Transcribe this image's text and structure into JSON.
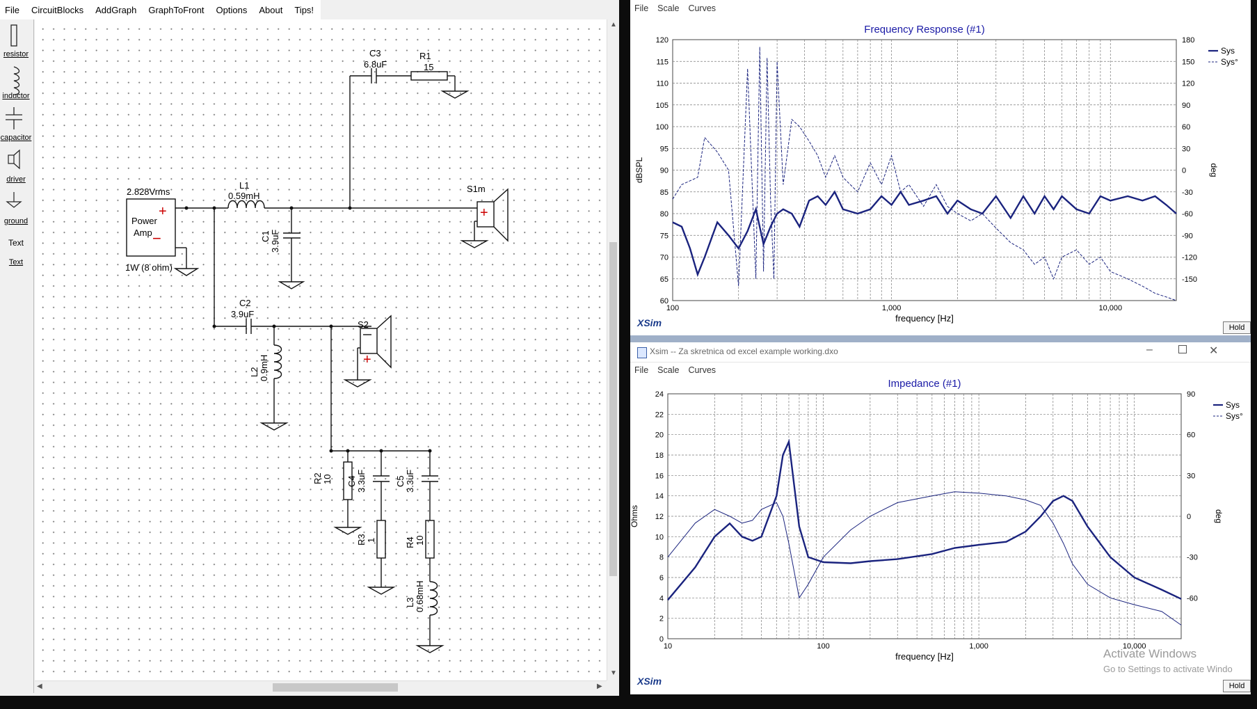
{
  "menu": [
    "File",
    "CircuitBlocks",
    "AddGraph",
    "GraphToFront",
    "Options",
    "About",
    "Tips!"
  ],
  "palette": [
    "resistor",
    "inductor",
    "capacitor",
    "driver",
    "ground",
    "Text",
    "Text"
  ],
  "circuit": {
    "source_voltage": "2.828Vrms",
    "source_name_1": "Power",
    "source_name_2": "Amp",
    "source_rating": "1W (8 ohm)",
    "L1_name": "L1",
    "L1_val": "0.59mH",
    "C3_name": "C3",
    "C3_val": "6.8uF",
    "R1_name": "R1",
    "R1_val": "15",
    "C1_name": "C1",
    "C1_val": "3.9uF",
    "S1_name": "S1m",
    "C2_name": "C2",
    "C2_val": "3.9uF",
    "L2_name": "L2",
    "L2_val": "0.9mH",
    "S2_name": "S2",
    "R2_name": "R2",
    "R2_val": "10",
    "C4_name": "C4",
    "C4_val": "3.3uF",
    "C5_name": "C5",
    "C5_val": "3.3uF",
    "R3_name": "R3",
    "R3_val": "1",
    "R4_name": "R4",
    "R4_val": "10",
    "L3_name": "L3",
    "L3_val": "0.68mH"
  },
  "graph_menu": [
    "File",
    "Scale",
    "Curves"
  ],
  "freq_window": {
    "hold_label": "Hold",
    "brand": "XSim"
  },
  "imp_window": {
    "title": "Xsim -- Za skretnica od excel example working.dxo",
    "hold_label": "Hold",
    "brand": "XSim"
  },
  "watermark": {
    "line1": "Activate Windows",
    "line2": "Go to Settings to activate Windo"
  },
  "colors": {
    "curve": "#1a237e",
    "title": "#1a1aa6",
    "grid": "#7a7a7a"
  },
  "chart_data": [
    {
      "type": "line",
      "title": "Frequency Response (#1)",
      "xlabel": "frequency [Hz]",
      "ylabel": "dBSPL",
      "y2label": "deg",
      "xscale": "log",
      "xlim": [
        100,
        20000
      ],
      "ylim": [
        60,
        120
      ],
      "y2lim": [
        -180,
        180
      ],
      "x_ticks": [
        "100",
        "1,000",
        "10,000"
      ],
      "y_ticks": [
        "60",
        "65",
        "70",
        "75",
        "80",
        "85",
        "90",
        "95",
        "100",
        "105",
        "110",
        "115",
        "120"
      ],
      "y2_ticks": [
        "-150",
        "-120",
        "-90",
        "-60",
        "-30",
        "0",
        "30",
        "60",
        "90",
        "120",
        "150",
        "180"
      ],
      "legend": [
        "Sys",
        "Sys°"
      ],
      "legend_position": "top-right",
      "series": [
        {
          "name": "Sys",
          "style": "solid",
          "x": [
            100,
            110,
            120,
            130,
            140,
            160,
            180,
            200,
            220,
            240,
            260,
            280,
            300,
            320,
            350,
            380,
            420,
            460,
            500,
            550,
            600,
            700,
            800,
            900,
            1000,
            1100,
            1200,
            1400,
            1600,
            1800,
            2000,
            2300,
            2600,
            3000,
            3500,
            4000,
            4500,
            5000,
            5500,
            6000,
            7000,
            8000,
            9000,
            10000,
            12000,
            14000,
            16000,
            18000,
            20000
          ],
          "y": [
            78,
            77,
            72,
            66,
            70,
            78,
            75,
            72,
            76,
            81,
            73,
            77,
            80,
            81,
            80,
            77,
            83,
            84,
            82,
            85,
            81,
            80,
            81,
            84,
            82,
            85,
            82,
            83,
            84,
            80,
            83,
            81,
            80,
            84,
            79,
            84,
            80,
            84,
            81,
            84,
            81,
            80,
            84,
            83,
            84,
            83,
            84,
            82,
            80
          ]
        },
        {
          "name": "Sys°",
          "style": "dashed",
          "x": [
            100,
            110,
            130,
            140,
            160,
            180,
            200,
            220,
            240,
            250,
            260,
            270,
            280,
            290,
            300,
            320,
            350,
            380,
            420,
            460,
            500,
            550,
            600,
            700,
            800,
            900,
            1000,
            1100,
            1200,
            1400,
            1600,
            1800,
            2000,
            2300,
            2600,
            3000,
            3500,
            4000,
            4500,
            5000,
            5500,
            6000,
            7000,
            8000,
            9000,
            10000,
            12000,
            14000,
            16000,
            18000,
            20000
          ],
          "y": [
            -40,
            -20,
            -10,
            45,
            25,
            0,
            -160,
            140,
            -150,
            170,
            -140,
            155,
            -40,
            -150,
            150,
            -20,
            70,
            60,
            40,
            20,
            -10,
            20,
            -10,
            -30,
            10,
            -20,
            20,
            -30,
            -20,
            -50,
            -20,
            -50,
            -60,
            -70,
            -60,
            -80,
            -100,
            -110,
            -130,
            -120,
            -150,
            -120,
            -110,
            -130,
            -120,
            -140,
            -150,
            -160,
            -170,
            -175,
            -180
          ]
        }
      ]
    },
    {
      "type": "line",
      "title": "Impedance (#1)",
      "xlabel": "frequency [Hz]",
      "ylabel": "Ohms",
      "y2label": "deg",
      "xscale": "log",
      "xlim": [
        10,
        20000
      ],
      "ylim": [
        0,
        24
      ],
      "y2lim": [
        -90,
        90
      ],
      "x_ticks": [
        "10",
        "100",
        "1,000",
        "10,000"
      ],
      "y_ticks": [
        "0",
        "2",
        "4",
        "6",
        "8",
        "10",
        "12",
        "14",
        "16",
        "18",
        "20",
        "22",
        "24"
      ],
      "y2_ticks": [
        "-60",
        "-30",
        "0",
        "30",
        "60",
        "90"
      ],
      "legend": [
        "Sys",
        "Sys°"
      ],
      "legend_position": "top-right",
      "series": [
        {
          "name": "Sys",
          "style": "solid",
          "x": [
            10,
            15,
            20,
            25,
            30,
            35,
            40,
            50,
            55,
            60,
            65,
            70,
            80,
            100,
            150,
            200,
            300,
            500,
            700,
            1000,
            1500,
            2000,
            2500,
            3000,
            3500,
            4000,
            5000,
            7000,
            10000,
            15000,
            20000
          ],
          "y": [
            3.8,
            7,
            10,
            11.3,
            10,
            9.6,
            10,
            14,
            18,
            19.3,
            15,
            11,
            8,
            7.5,
            7.4,
            7.6,
            7.8,
            8.3,
            8.9,
            9.2,
            9.5,
            10.5,
            12,
            13.5,
            14,
            13.5,
            11,
            8,
            6,
            4.8,
            3.9
          ],
          "thickness": "thick"
        },
        {
          "name": "Sys°",
          "style": "solid",
          "x": [
            10,
            15,
            20,
            25,
            30,
            35,
            40,
            50,
            55,
            60,
            70,
            80,
            100,
            150,
            200,
            300,
            500,
            700,
            1000,
            1500,
            2000,
            2500,
            3000,
            3500,
            4000,
            5000,
            7000,
            10000,
            15000,
            20000
          ],
          "y": [
            -30,
            -5,
            5,
            0,
            -5,
            -3,
            5,
            10,
            0,
            -20,
            -60,
            -50,
            -30,
            -10,
            0,
            10,
            15,
            18,
            17,
            15,
            12,
            8,
            -5,
            -20,
            -35,
            -50,
            -60,
            -65,
            -70,
            -80
          ],
          "thickness": "thin"
        }
      ]
    }
  ]
}
